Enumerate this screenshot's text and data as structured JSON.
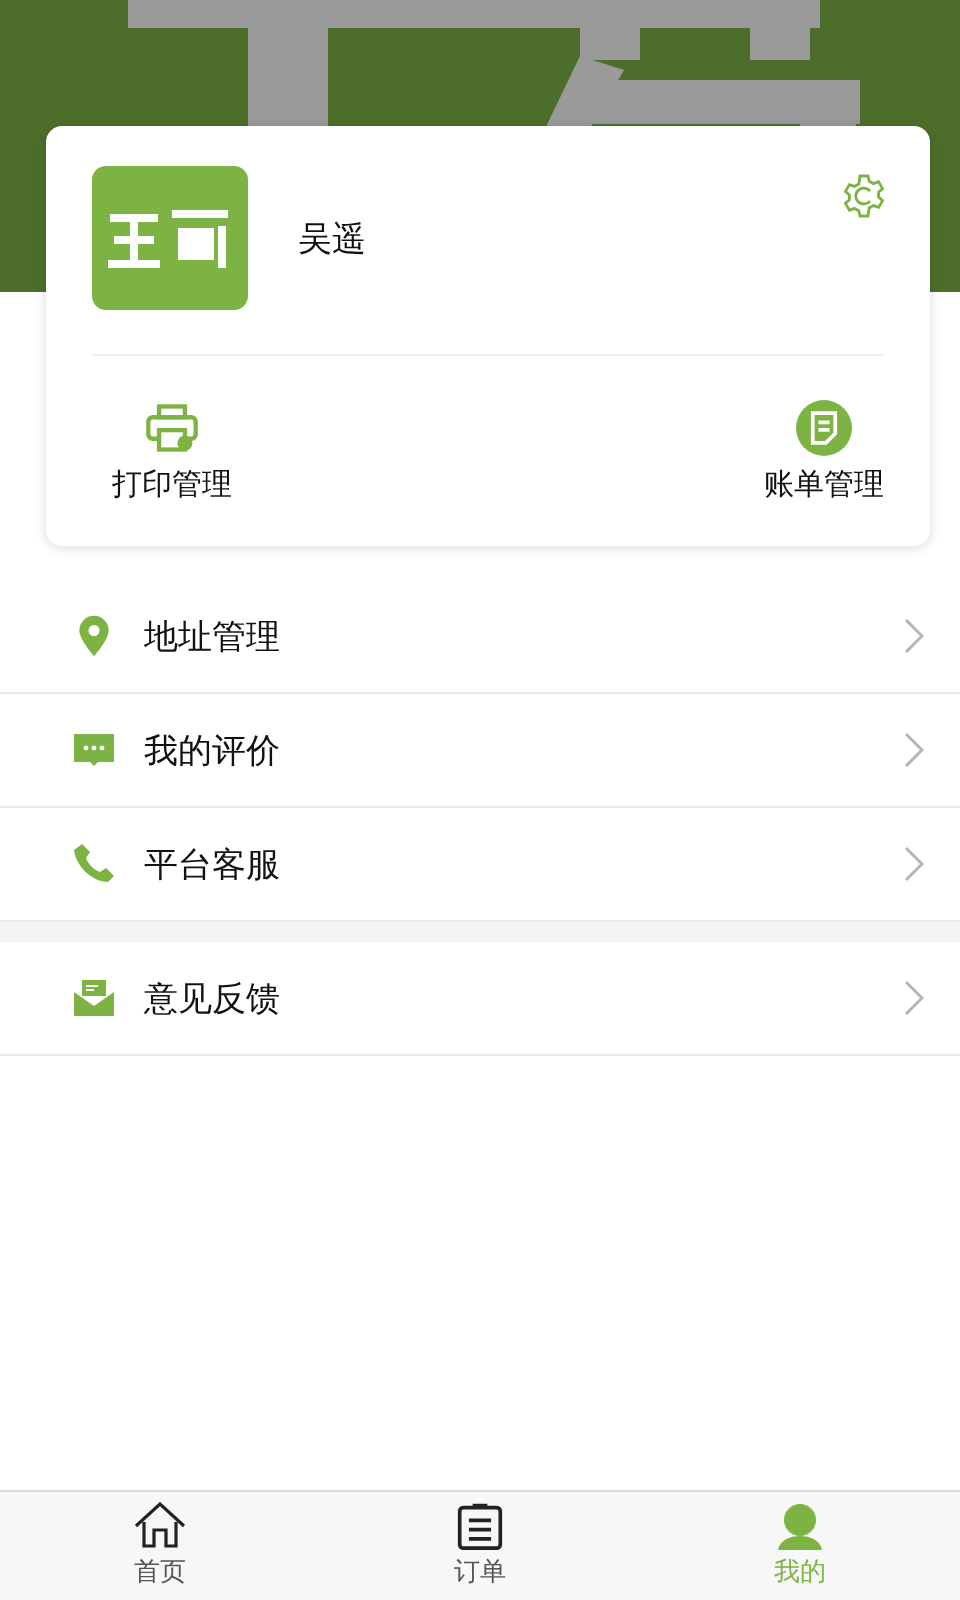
{
  "header": {
    "kind": "picture"
  },
  "profile": {
    "avatar": {
      "kind": "picture"
    },
    "name": "吴遥",
    "actions": [
      {
        "kind": "printer",
        "label": "打印管理"
      },
      {
        "kind": "bill",
        "label": "账单管理"
      }
    ]
  },
  "menu_groups": [
    [
      {
        "kind": "pin",
        "label": "地址管理"
      },
      {
        "kind": "chat",
        "label": "我的评价"
      },
      {
        "kind": "phone",
        "label": "平台客服"
      }
    ],
    [
      {
        "kind": "mail",
        "label": "意见反馈"
      }
    ]
  ],
  "tab_bar": [
    {
      "kind": "home",
      "label": "首页",
      "selected": false
    },
    {
      "kind": "clipboard",
      "label": "订单",
      "selected": false
    },
    {
      "kind": "person",
      "label": "我的",
      "selected": true
    }
  ]
}
